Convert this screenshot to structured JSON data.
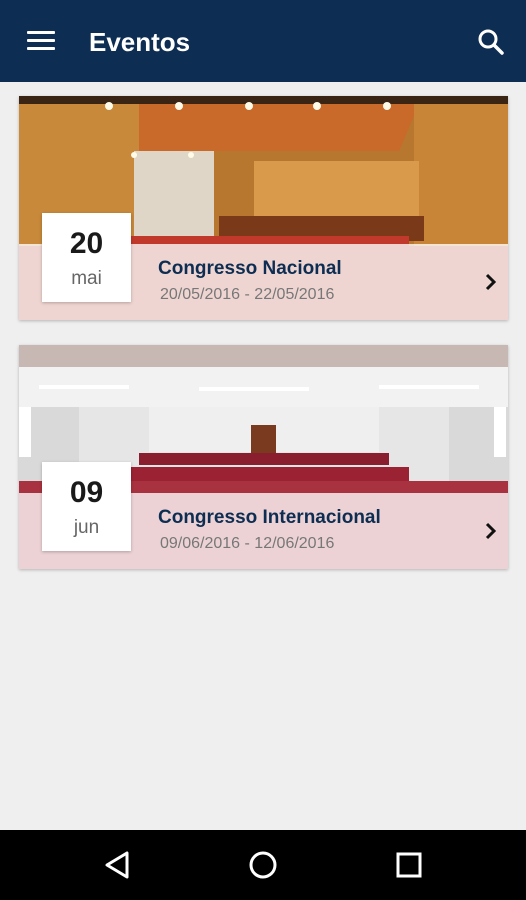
{
  "app_bar": {
    "title": "Eventos",
    "menu_icon": "hamburger-menu-icon",
    "search_icon": "search-icon",
    "background": "#0d2d52"
  },
  "events": [
    {
      "day": "20",
      "month": "mai",
      "name": "Congresso Nacional",
      "date_range": "20/05/2016 - 22/05/2016",
      "image": "auditorium-wood-photo",
      "chevron_icon": "chevron-right-icon"
    },
    {
      "day": "09",
      "month": "jun",
      "name": "Congresso Internacional",
      "date_range": "09/06/2016 - 12/06/2016",
      "image": "auditorium-white-photo",
      "chevron_icon": "chevron-right-icon"
    }
  ],
  "nav_bar": {
    "back_icon": "back-triangle-icon",
    "home_icon": "home-circle-icon",
    "recents_icon": "recents-square-icon"
  }
}
